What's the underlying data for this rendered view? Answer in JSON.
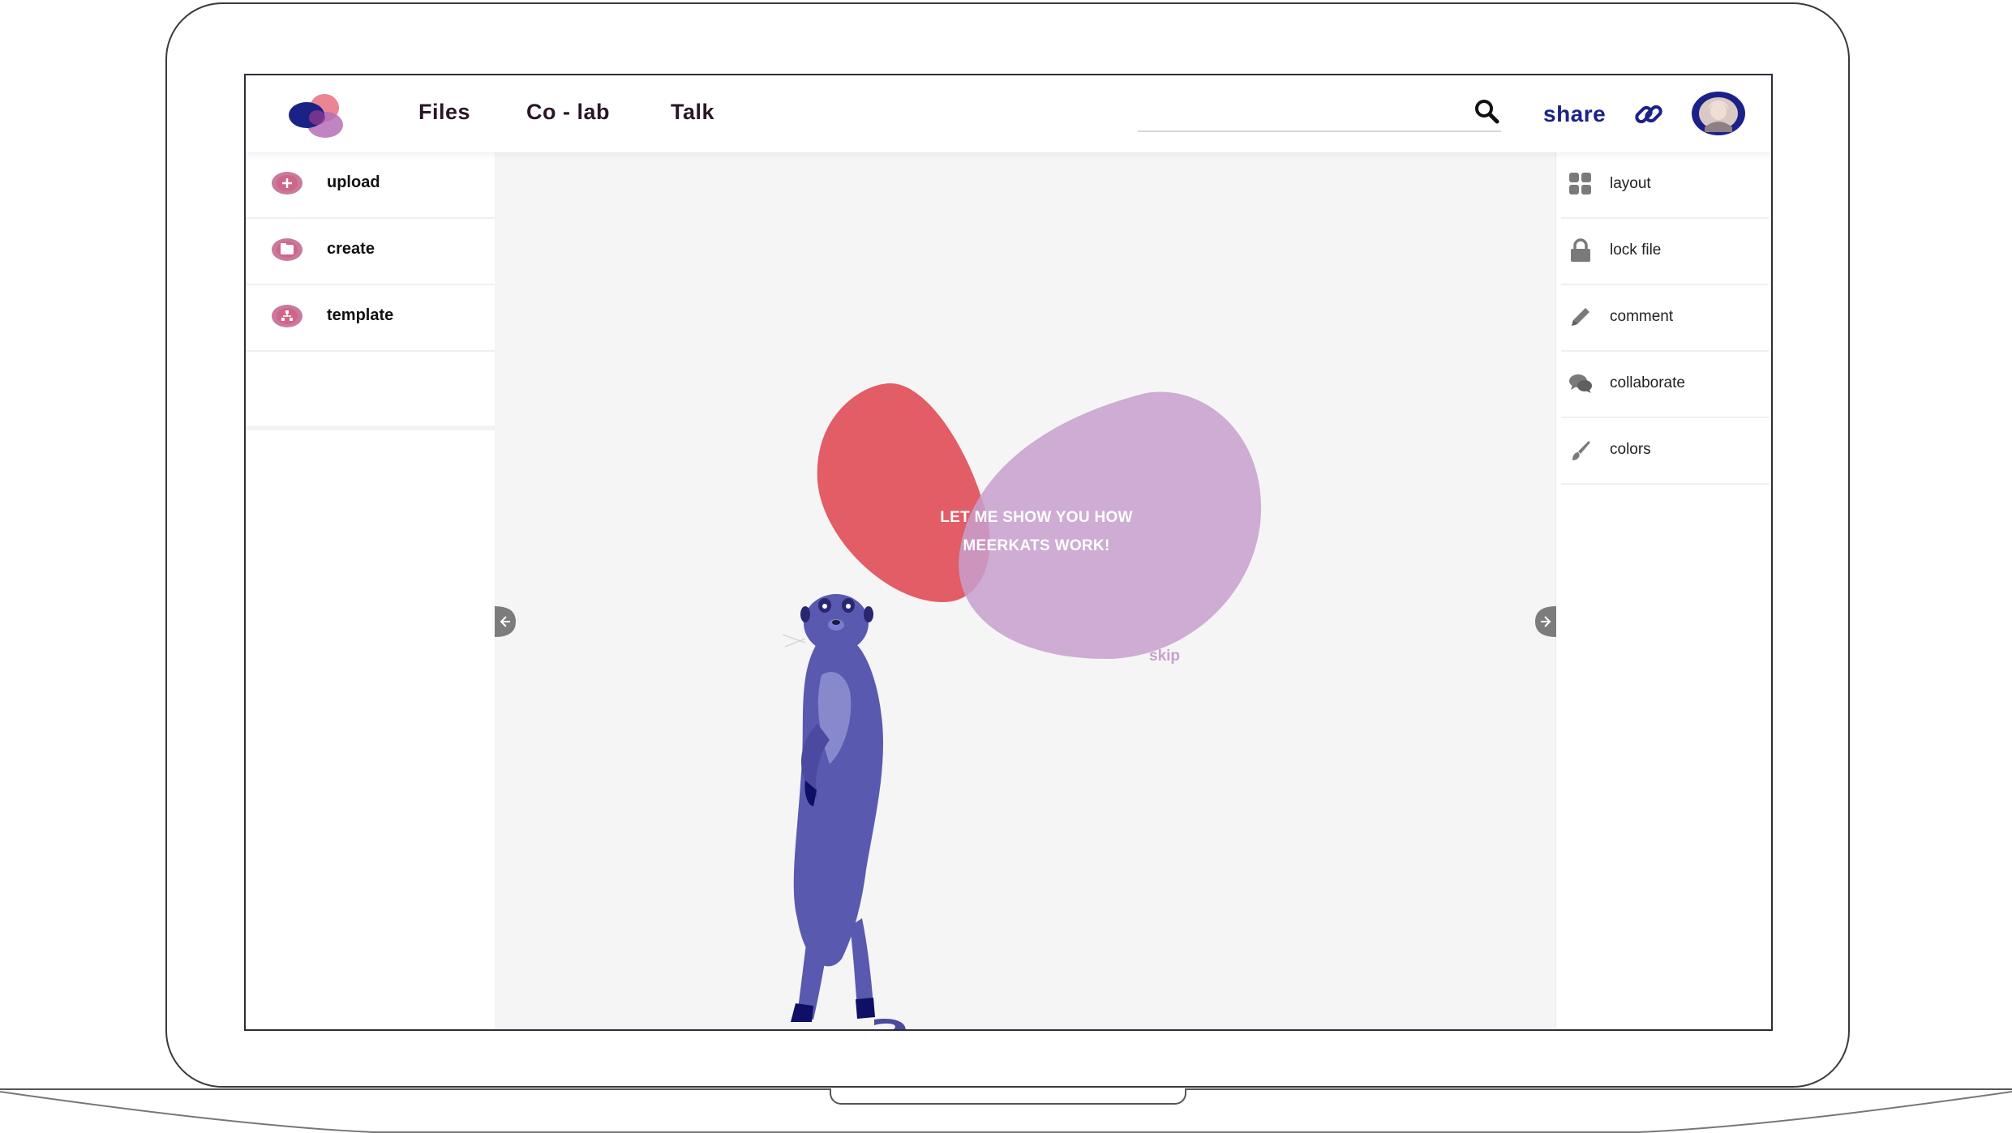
{
  "colors": {
    "brand_navy": "#1b2287",
    "brand_pink": "#c97a9c",
    "blob_red": "#e0545e",
    "blob_purple": "#c79fce",
    "meerkat": "#5a59b0",
    "nav_text": "#2b1626"
  },
  "header": {
    "nav": [
      "Files",
      "Co - lab",
      "Talk"
    ],
    "search": {
      "value": "",
      "placeholder": ""
    },
    "share_label": "share"
  },
  "left_panel": {
    "items": [
      {
        "label": "upload",
        "icon": "plus-icon"
      },
      {
        "label": "create",
        "icon": "folder-icon"
      },
      {
        "label": "template",
        "icon": "template-icon"
      }
    ]
  },
  "right_panel": {
    "items": [
      {
        "label": "layout",
        "icon": "grid-icon"
      },
      {
        "label": "lock file",
        "icon": "lock-icon"
      },
      {
        "label": "comment",
        "icon": "pencil-icon"
      },
      {
        "label": "collaborate",
        "icon": "chat-bubbles-icon"
      },
      {
        "label": "colors",
        "icon": "paintbrush-icon"
      }
    ]
  },
  "onboarding": {
    "line1": "LET ME SHOW YOU HOW",
    "line2": "MEERKATS WORK!",
    "skip_label": "skip"
  }
}
